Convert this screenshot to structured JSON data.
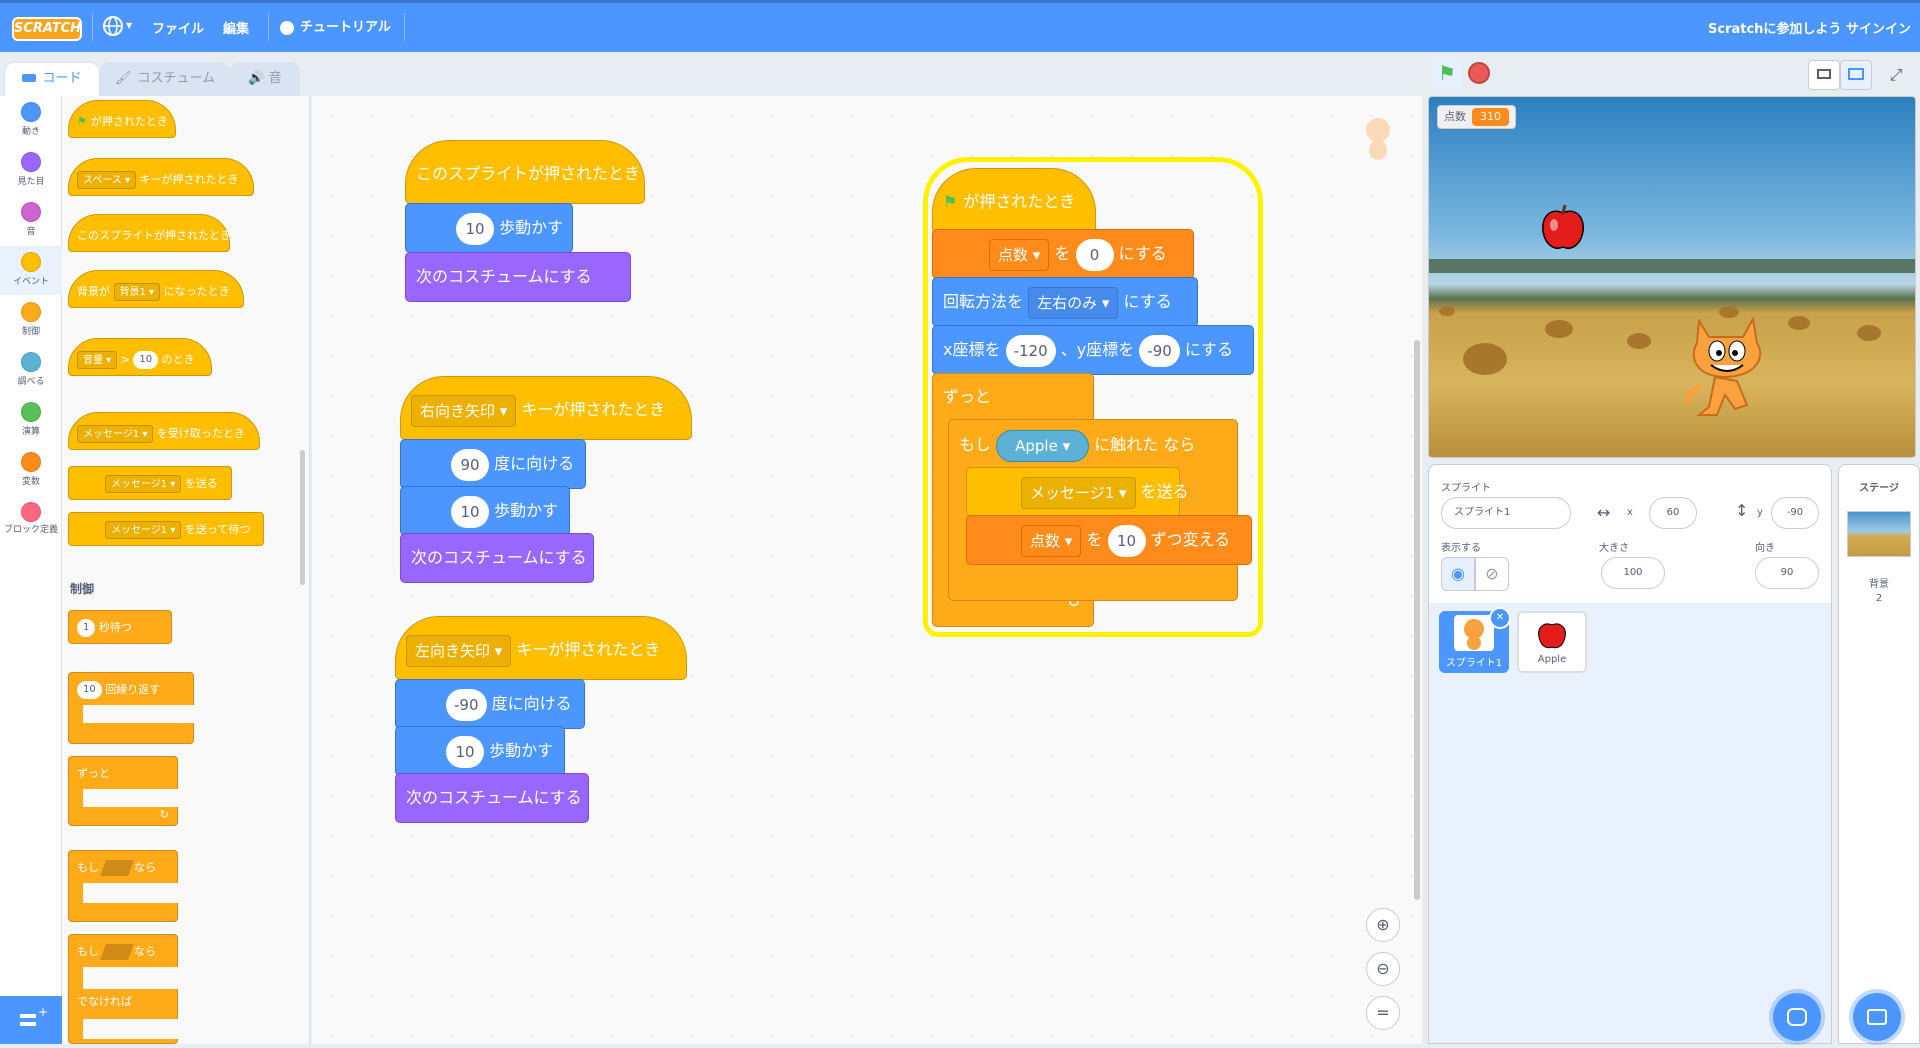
{
  "menu": {
    "logo": "SCRATCH",
    "file": "ファイル",
    "edit": "編集",
    "tutorials": "チュートリアル",
    "join": "Scratchに参加しよう",
    "signin": "サインイン"
  },
  "tabs": {
    "code": "コード",
    "costumes": "コスチューム",
    "sounds": "音"
  },
  "categories": [
    "動き",
    "見た目",
    "音",
    "イベント",
    "制御",
    "調べる",
    "演算",
    "変数",
    "ブロック定義"
  ],
  "category_colors": [
    "#4c97ff",
    "#9966ff",
    "#cf63cf",
    "#ffbf00",
    "#ffab19",
    "#5cb1d6",
    "#59c059",
    "#ff8c1a",
    "#ff6680"
  ],
  "palette": {
    "flag_clicked": "が押されたとき",
    "key_pressed_dropdown": "スペース",
    "key_pressed_text": "キーが押されたとき",
    "sprite_clicked": "このスプライトが押されたとき",
    "backdrop_prefix": "背景が",
    "backdrop_dropdown": "背景1",
    "backdrop_suffix": "になったとき",
    "loudness_dropdown": "音量",
    "loudness_op": ">",
    "loudness_value": "10",
    "loudness_suffix": "のとき",
    "message_dropdown": "メッセージ1",
    "receive_text": "を受け取ったとき",
    "broadcast_text": "を送る",
    "broadcast_wait_text": "を送って待つ",
    "control_header": "制御",
    "wait_value": "1",
    "wait_text": "秒待つ",
    "repeat_value": "10",
    "repeat_text": "回繰り返す",
    "forever_text": "ずっと",
    "if_text": "もし",
    "then_text": "なら",
    "else_text": "でなければ"
  },
  "scripts": {
    "s1": {
      "hat": "このスプライトが押されたとき",
      "move_value": "10",
      "move_text": "歩動かす",
      "next_costume": "次のコスチュームにする"
    },
    "s2": {
      "key": "右向き矢印",
      "hat_text": "キーが押されたとき",
      "dir_value": "90",
      "dir_text": "度に向ける",
      "move_value": "10",
      "move_text": "歩動かす",
      "next_costume": "次のコスチュームにする"
    },
    "s3": {
      "key": "左向き矢印",
      "hat_text": "キーが押されたとき",
      "dir_value": "-90",
      "dir_text": "度に向ける",
      "move_value": "10",
      "move_text": "歩動かす",
      "next_costume": "次のコスチュームにする"
    },
    "s4": {
      "hat": "が押されたとき",
      "set_var": "点数",
      "set_wo": "を",
      "set_value": "0",
      "set_text": "にする",
      "rot_text": "回転方法を",
      "rot_value": "左右のみ",
      "rot_suffix": "にする",
      "goto_x_text": "x座標を",
      "goto_x": "-120",
      "goto_y_text": "、y座標を",
      "goto_y": "-90",
      "goto_suffix": "にする",
      "forever": "ずっと",
      "if_text": "もし",
      "touch_target": "Apple",
      "touch_text": "に触れた",
      "then_text": "なら",
      "broadcast": "メッセージ1",
      "broadcast_text": "を送る",
      "change_var": "点数",
      "change_wo": "を",
      "change_value": "10",
      "change_text": "ずつ変える"
    }
  },
  "zoom_icons": [
    "zoom-in",
    "zoom-out",
    "zoom-reset"
  ],
  "stage": {
    "monitor_label": "点数",
    "monitor_value": "310"
  },
  "sprite_info": {
    "sprite_label": "スプライト",
    "sprite_name": "スプライト1",
    "x_label": "x",
    "x_value": "60",
    "y_label": "y",
    "y_value": "-90",
    "show_label": "表示する",
    "size_label": "大きさ",
    "size_value": "100",
    "direction_label": "向き",
    "direction_value": "90"
  },
  "sprite_list": [
    {
      "name": "スプライト1"
    },
    {
      "name": "Apple"
    }
  ],
  "stage_pane": {
    "title": "ステージ",
    "backdrop_label": "背景",
    "backdrop_count": "2"
  }
}
